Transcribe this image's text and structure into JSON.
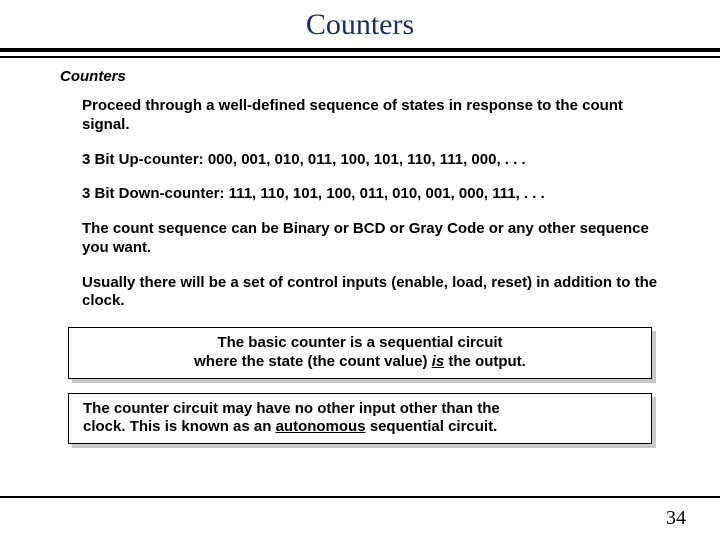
{
  "title": "Counters",
  "section_heading": "Counters",
  "paragraphs": {
    "p1": "Proceed through a well-defined sequence of states in response to the count signal.",
    "p2": "3 Bit Up-counter: 000, 001, 010, 011, 100, 101, 110, 111, 000, . . .",
    "p3": "3 Bit Down-counter:  111, 110, 101, 100, 011, 010, 001, 000, 111, . . .",
    "p4": "The count sequence can be Binary or BCD or Gray Code or any other sequence you want.",
    "p5": "Usually there will be a set of control inputs (enable, load, reset) in addition to the clock."
  },
  "callout1": {
    "line1": "The basic counter is a sequential circuit",
    "line2a": "where the state (the count value) ",
    "line2_is": "is",
    "line2b": " the output."
  },
  "callout2": {
    "line1": "The counter circuit may have no other input other than the",
    "line2a": "clock.  This is known as an ",
    "line2_auto": "autonomous",
    "line2b": " sequential circuit."
  },
  "page_number": "34"
}
